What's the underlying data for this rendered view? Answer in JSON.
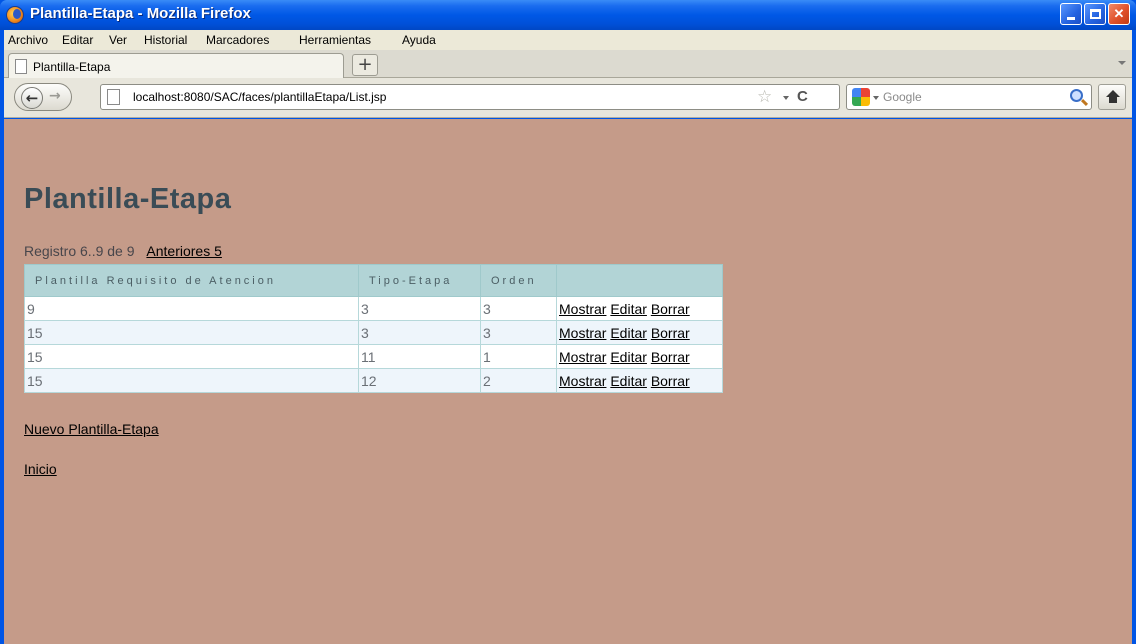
{
  "window": {
    "title": "Plantilla-Etapa - Mozilla Firefox"
  },
  "menu": {
    "items": [
      "Archivo",
      "Editar",
      "Ver",
      "Historial",
      "Marcadores",
      "Herramientas",
      "Ayuda"
    ]
  },
  "tabs": [
    {
      "label": "Plantilla-Etapa"
    }
  ],
  "newtab_label": "+",
  "navigation": {
    "url": "localhost:8080/SAC/faces/plantillaEtapa/List.jsp",
    "search_placeholder": "Google",
    "back_icon": "back-arrow-icon",
    "forward_icon": "forward-arrow-icon",
    "reload_icon": "reload-icon",
    "home_icon": "home-icon"
  },
  "page": {
    "title": "Plantilla-Etapa",
    "paging_text": "Registro 6..9 de 9",
    "previous_link": "Anteriores 5",
    "table": {
      "headers": [
        "Plantilla Requisito de Atencion",
        "Tipo-Etapa",
        "Orden",
        ""
      ],
      "rows": [
        {
          "plantilla": "9",
          "tipo_etapa": "3",
          "orden": "3"
        },
        {
          "plantilla": "15",
          "tipo_etapa": "3",
          "orden": "3"
        },
        {
          "plantilla": "15",
          "tipo_etapa": "11",
          "orden": "1"
        },
        {
          "plantilla": "15",
          "tipo_etapa": "12",
          "orden": "2"
        }
      ],
      "actions": {
        "show": "Mostrar",
        "edit": "Editar",
        "delete": "Borrar"
      }
    },
    "new_link": "Nuevo Plantilla-Etapa",
    "home_link": "Inicio"
  },
  "colors": {
    "content_bg": "#c59b89",
    "title_color": "#3a4c56",
    "table_header_bg": "#b2d4d6",
    "row_even_bg": "#eef5fb"
  }
}
